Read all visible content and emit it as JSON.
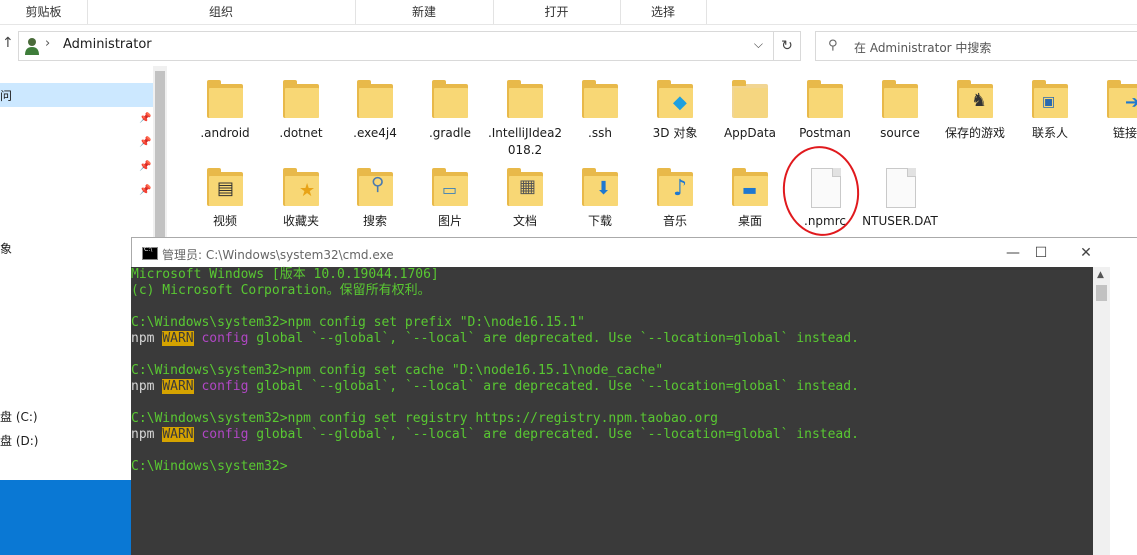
{
  "ribbon": {
    "groups": [
      "剪贴板",
      "组织",
      "新建",
      "打开",
      "选择"
    ]
  },
  "address": {
    "path": "Administrator",
    "search_placeholder": "在 Administrator 中搜索"
  },
  "nav": {
    "items": [
      "问",
      "象",
      "盘 (C:)",
      "盘 (D:)"
    ]
  },
  "files": [
    {
      "name": ".android",
      "kind": "folder"
    },
    {
      "name": ".dotnet",
      "kind": "folder"
    },
    {
      "name": ".exe4j4",
      "kind": "folder"
    },
    {
      "name": ".gradle",
      "kind": "folder"
    },
    {
      "name": ".IntelliJIdea2018.2",
      "kind": "folder"
    },
    {
      "name": ".ssh",
      "kind": "folder"
    },
    {
      "name": "3D 对象",
      "kind": "folder"
    },
    {
      "name": "AppData",
      "kind": "folder"
    },
    {
      "name": "Postman",
      "kind": "folder"
    },
    {
      "name": "source",
      "kind": "folder"
    },
    {
      "name": "保存的游戏",
      "kind": "folder"
    },
    {
      "name": "联系人",
      "kind": "folder"
    },
    {
      "name": "链接",
      "kind": "folder"
    },
    {
      "name": "视频",
      "kind": "folder"
    },
    {
      "name": "收藏夹",
      "kind": "folder"
    },
    {
      "name": "搜索",
      "kind": "folder"
    },
    {
      "name": "图片",
      "kind": "folder"
    },
    {
      "name": "文档",
      "kind": "folder"
    },
    {
      "name": "下载",
      "kind": "folder"
    },
    {
      "name": "音乐",
      "kind": "folder"
    },
    {
      "name": "桌面",
      "kind": "folder"
    },
    {
      "name": ".npmrc",
      "kind": "file"
    },
    {
      "name": "NTUSER.DAT",
      "kind": "file"
    }
  ],
  "cmd": {
    "title": "管理员: C:\\Windows\\system32\\cmd.exe",
    "controls": {
      "minimize": "—",
      "maximize": "☐",
      "close": "✕"
    },
    "lines": {
      "l1": "Microsoft Windows [版本 10.0.19044.1706]",
      "l2": "(c) Microsoft Corporation。保留所有权利。",
      "c1": "C:\\Windows\\system32>npm config set prefix \"D:\\node16.15.1\"",
      "c2": "C:\\Windows\\system32>npm config set cache \"D:\\node16.15.1\\node_cache\"",
      "c3": "C:\\Windows\\system32>npm config set registry https://registry.npm.taobao.org",
      "prompt": "C:\\Windows\\system32>",
      "npm": "npm",
      "warn": "WARN",
      "config": "config",
      "rest": " global `--global`, `--local` are deprecated. Use `--location=global` instead."
    }
  },
  "colors": {
    "console_bg": "#3a3a3a",
    "console_green": "#59c832",
    "warn_bg": "#d5a300",
    "highlight_circle": "#e0191d"
  }
}
